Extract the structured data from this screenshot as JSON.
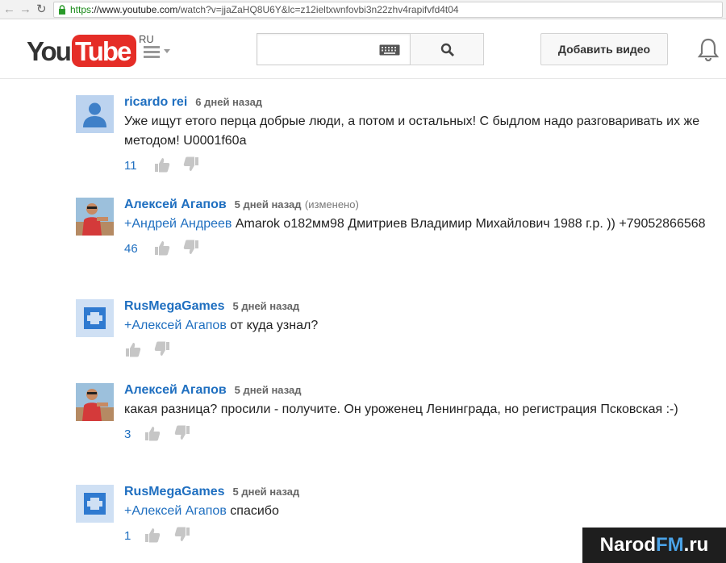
{
  "browser": {
    "url_scheme": "https",
    "url_host": "://www.youtube.com",
    "url_path": "/watch?v=jjaZaHQ8U6Y&lc=z12ieltxwnfovbi3n22zhv4rapifvfd4t04"
  },
  "header": {
    "logo_you": "You",
    "logo_tube": "Tube",
    "logo_region": "RU",
    "search_value": "",
    "upload_label": "Добавить видео"
  },
  "comments": [
    {
      "author": "ricardo rei",
      "time": "6 дней назад",
      "edited": "",
      "mention": "",
      "text": "Уже ищут етого перца добрые люди, а потом и остальных! С быдлом надо разговаривать их же методом! U0001f60a",
      "likes": "11",
      "avatar": "default"
    },
    {
      "author": "Алексей Агапов",
      "time": "5 дней назад",
      "edited": "(изменено)",
      "mention": "+Андрей Андреев",
      "text": " Amarok о182мм98 Дмитриев Владимир Михайлович 1988 г.р. )) +79052866568",
      "likes": "46",
      "avatar": "photo"
    },
    {
      "author": "RusMegaGames",
      "time": "5 дней назад",
      "edited": "",
      "mention": "+Алексей Агапов",
      "text": " от куда узнал?",
      "likes": "",
      "avatar": "channel"
    },
    {
      "author": "Алексей Агапов",
      "time": "5 дней назад",
      "edited": "",
      "mention": "",
      "text": "какая разница? просили - получите. Он уроженец Ленинграда, но регистрация Псковская :-)",
      "likes": "3",
      "avatar": "photo"
    },
    {
      "author": "RusMegaGames",
      "time": "5 дней назад",
      "edited": "",
      "mention": "+Алексей Агапов",
      "text": " спасибо",
      "likes": "1",
      "avatar": "channel"
    }
  ],
  "watermark": {
    "part1": "Narod",
    "part2": "FM",
    "part3": ".ru"
  },
  "colors": {
    "link_blue": "#1f6fc0",
    "logo_red": "#e52d27",
    "url_green": "#1a8a1a"
  }
}
